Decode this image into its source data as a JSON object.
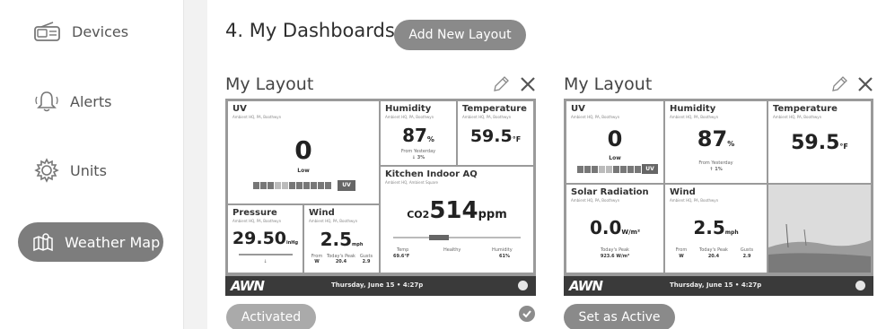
{
  "sidebar": {
    "items": [
      {
        "label": "Devices",
        "icon": "radio-icon"
      },
      {
        "label": "Alerts",
        "icon": "bell-icon"
      },
      {
        "label": "Units",
        "icon": "gear-icon"
      },
      {
        "label": "Weather Map",
        "icon": "map-icon",
        "active": true
      }
    ]
  },
  "main": {
    "heading": "4. My Dashboards",
    "add_layout_label": "Add New Layout"
  },
  "layouts": [
    {
      "title": "My Layout",
      "status_button": "Activated",
      "active": true,
      "tiles": {
        "uv": {
          "title": "UV",
          "sub": "Ambient HQ, PA, Boothwyn",
          "value": "0",
          "label": "Low",
          "badge": "UV"
        },
        "humidity": {
          "title": "Humidity",
          "sub": "Ambient HQ, PA, Boothwyn",
          "value": "87",
          "unit": "%",
          "note1": "From Yesterday",
          "note2": "↓ 3%"
        },
        "temperature": {
          "title": "Temperature",
          "sub": "Ambient HQ, PA, Boothwyn",
          "value": "59.5",
          "unit": "°F"
        },
        "aq": {
          "title": "Kitchen Indoor AQ",
          "sub": "Ambient HQ, Ambient Square",
          "prefix": "CO2",
          "value": "514",
          "unit": "ppm",
          "temp_label": "Temp",
          "temp_value": "69.6°F",
          "status": "Healthy",
          "hum_label": "Humidity",
          "hum_value": "61%"
        },
        "pressure": {
          "title": "Pressure",
          "sub": "Ambient HQ, PA, Boothwyn",
          "value": "29.50",
          "unit": "inHg",
          "trend": "↓"
        },
        "wind": {
          "title": "Wind",
          "sub": "Ambient HQ, PA, Boothwyn",
          "value": "2.5",
          "unit": "mph",
          "from_label": "From",
          "from_value": "W",
          "peak_label": "Today's Peak",
          "peak_value": "20.4",
          "gusts_label": "Gusts",
          "gusts_value": "2.9"
        }
      },
      "footer": {
        "logo": "AWN",
        "date": "Thursday, June 15 • 4:27p"
      }
    },
    {
      "title": "My Layout",
      "status_button": "Set as Active",
      "active": false,
      "tiles": {
        "uv": {
          "title": "UV",
          "sub": "Ambient HQ, PA, Boothwyn",
          "value": "0",
          "label": "Low",
          "badge": "UV"
        },
        "humidity": {
          "title": "Humidity",
          "sub": "Ambient HQ, PA, Boothwyn",
          "value": "87",
          "unit": "%",
          "note1": "From Yesterday",
          "note2": "↑ 1%"
        },
        "temperature": {
          "title": "Temperature",
          "sub": "Ambient HQ, PA, Boothwyn",
          "value": "59.5",
          "unit": "°F"
        },
        "solar": {
          "title": "Solar Radiation",
          "sub": "Ambient HQ, PA, Boothwyn",
          "value": "0.0",
          "unit": "W/m²",
          "peak_label": "Today's Peak",
          "peak_value": "923.6 W/m²"
        },
        "wind": {
          "title": "Wind",
          "sub": "Ambient HQ, PA, Boothwyn",
          "value": "2.5",
          "unit": "mph",
          "from_label": "From",
          "from_value": "W",
          "peak_label": "Today's Peak",
          "peak_value": "20.4",
          "gusts_label": "Gusts",
          "gusts_value": "2.9"
        }
      },
      "footer": {
        "logo": "AWN",
        "date": "Thursday, June 15 • 4:27p"
      }
    }
  ]
}
